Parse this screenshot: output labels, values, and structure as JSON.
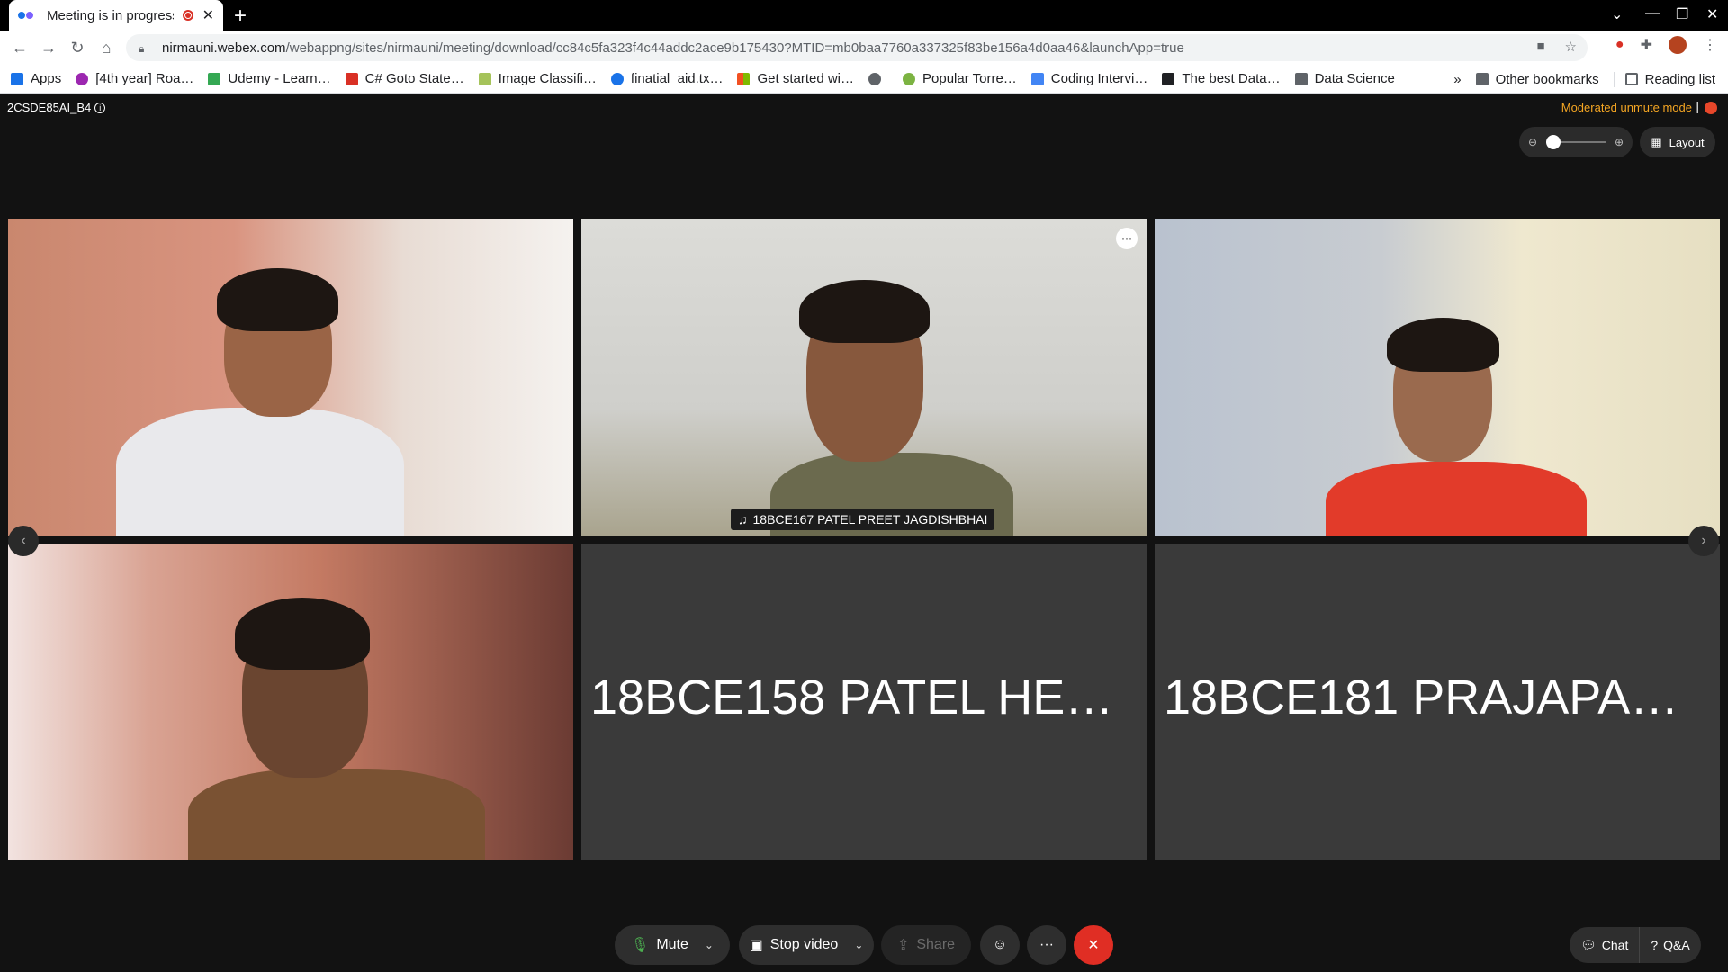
{
  "browser": {
    "tab_title": "Meeting is in progress",
    "url_host": "nirmauni.webex.com",
    "url_path": "/webappng/sites/nirmauni/meeting/download/cc84c5fa323f4c44addc2ace9b175430?MTID=mb0baa7760a337325f83be156a4d0aa46&launchApp=true",
    "bookmarks": [
      {
        "label": "Apps",
        "color": "#1a73e8"
      },
      {
        "label": "[4th year] Roa…",
        "color": "#9c27b0"
      },
      {
        "label": "Udemy - Learn…",
        "color": "#34a853"
      },
      {
        "label": "C# Goto State…",
        "color": "#d93025"
      },
      {
        "label": "Image Classifi…",
        "color": "#a5c35a"
      },
      {
        "label": "finatial_aid.tx…",
        "color": "#1a73e8"
      },
      {
        "label": "Get started wi…",
        "color": "#f25022"
      },
      {
        "label": "",
        "color": "#5f6368"
      },
      {
        "label": "Popular Torre…",
        "color": "#7cb342"
      },
      {
        "label": "Coding Intervi…",
        "color": "#4285f4"
      },
      {
        "label": "The best Data…",
        "color": "#202124"
      },
      {
        "label": "Data Science",
        "color": "#5f6368"
      }
    ],
    "more_bookmarks": "»",
    "other_bookmarks": "Other bookmarks",
    "reading_list": "Reading list"
  },
  "meeting": {
    "name": "2CSDE85AI_B4",
    "moderated": "Moderated unmute mode",
    "separator": "|",
    "layout_label": "Layout"
  },
  "participants": {
    "speaker_name": "18BCE167 PATEL PREET JAGDISHBHAI",
    "tile5_name": "18BCE158 PATEL HE…",
    "tile6_name": "18BCE181 PRAJAPA…"
  },
  "controls": {
    "mute": "Mute",
    "stop_video": "Stop video",
    "share": "Share",
    "chat": "Chat",
    "qa": "Q&A"
  },
  "colors": {
    "accent_warning": "#f5a623",
    "leave": "#e02e24"
  }
}
